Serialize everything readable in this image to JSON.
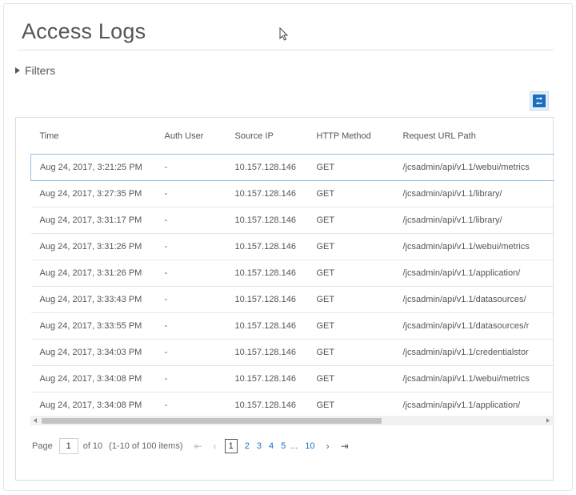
{
  "page": {
    "title": "Access Logs"
  },
  "filters": {
    "label": "Filters"
  },
  "table": {
    "columns": [
      "Time",
      "Auth User",
      "Source IP",
      "HTTP Method",
      "Request URL Path"
    ],
    "rows": [
      [
        "Aug 24, 2017, 3:21:25 PM",
        "-",
        "10.157.128.146",
        "GET",
        "/jcsadmin/api/v1.1/webui/metrics"
      ],
      [
        "Aug 24, 2017, 3:27:35 PM",
        "-",
        "10.157.128.146",
        "GET",
        "/jcsadmin/api/v1.1/library/"
      ],
      [
        "Aug 24, 2017, 3:31:17 PM",
        "-",
        "10.157.128.146",
        "GET",
        "/jcsadmin/api/v1.1/library/"
      ],
      [
        "Aug 24, 2017, 3:31:26 PM",
        "-",
        "10.157.128.146",
        "GET",
        "/jcsadmin/api/v1.1/webui/metrics"
      ],
      [
        "Aug 24, 2017, 3:31:26 PM",
        "-",
        "10.157.128.146",
        "GET",
        "/jcsadmin/api/v1.1/application/"
      ],
      [
        "Aug 24, 2017, 3:33:43 PM",
        "-",
        "10.157.128.146",
        "GET",
        "/jcsadmin/api/v1.1/datasources/"
      ],
      [
        "Aug 24, 2017, 3:33:55 PM",
        "-",
        "10.157.128.146",
        "GET",
        "/jcsadmin/api/v1.1/datasources/r"
      ],
      [
        "Aug 24, 2017, 3:34:03 PM",
        "-",
        "10.157.128.146",
        "GET",
        "/jcsadmin/api/v1.1/credentialstor"
      ],
      [
        "Aug 24, 2017, 3:34:08 PM",
        "-",
        "10.157.128.146",
        "GET",
        "/jcsadmin/api/v1.1/webui/metrics"
      ],
      [
        "Aug 24, 2017, 3:34:08 PM",
        "-",
        "10.157.128.146",
        "GET",
        "/jcsadmin/api/v1.1/application/"
      ]
    ]
  },
  "pagination": {
    "page_label": "Page",
    "current_page": "1",
    "of_label": "of 10",
    "items_info": "(1-10 of 100 items)",
    "first_icon": "first-page-icon",
    "prev_icon": "previous-page-icon",
    "next_icon": "next-page-icon",
    "last_icon": "last-page-icon",
    "pages": [
      "1",
      "2",
      "3",
      "4",
      "5"
    ],
    "ellipsis": "...",
    "last_page": "10"
  },
  "icons": {
    "refresh": "refresh-icon",
    "filters_toggle": "caret-right-icon",
    "cursor": "mouse-cursor-icon"
  },
  "colors": {
    "accent": "#1a6ec2",
    "selected_row_border": "#8fc0ea"
  }
}
